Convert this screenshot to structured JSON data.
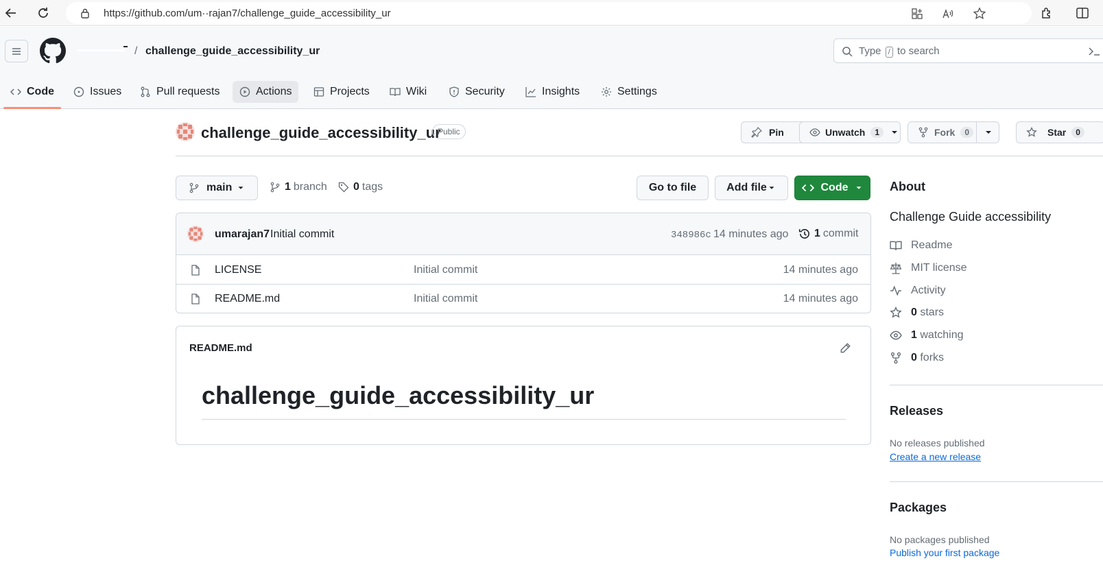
{
  "browser": {
    "url": "https://github.com/um··rajan7/challenge_guide_accessibility_ur"
  },
  "header": {
    "separator": "/",
    "repo_crumb": "challenge_guide_accessibility_ur",
    "search_prefix": "Type",
    "search_key": "/",
    "search_suffix": "to search"
  },
  "tabs": [
    {
      "label": "Code",
      "icon": "code-icon"
    },
    {
      "label": "Issues",
      "icon": "issue-icon"
    },
    {
      "label": "Pull requests",
      "icon": "pull-request-icon"
    },
    {
      "label": "Actions",
      "icon": "play-icon"
    },
    {
      "label": "Projects",
      "icon": "table-icon"
    },
    {
      "label": "Wiki",
      "icon": "book-icon"
    },
    {
      "label": "Security",
      "icon": "shield-icon"
    },
    {
      "label": "Insights",
      "icon": "graph-icon"
    },
    {
      "label": "Settings",
      "icon": "gear-icon"
    }
  ],
  "repo": {
    "name": "challenge_guide_accessibility_ur",
    "visibility": "Public",
    "pin": "Pin",
    "unwatch": "Unwatch",
    "watch_count": "1",
    "fork": "Fork",
    "fork_count": "0",
    "star": "Star",
    "star_count": "0"
  },
  "toolbar": {
    "branch": "main",
    "branch_count": "1",
    "branch_label": "branch",
    "tag_count": "0",
    "tag_label": "tags",
    "go_to_file": "Go to file",
    "add_file": "Add file",
    "code": "Code"
  },
  "commit": {
    "author": "umarajan7",
    "message": "Initial commit",
    "hash": "348986c",
    "time": "14 minutes ago",
    "count": "1",
    "count_label": "commit"
  },
  "files": [
    {
      "name": "LICENSE",
      "message": "Initial commit",
      "age": "14 minutes ago"
    },
    {
      "name": "README.md",
      "message": "Initial commit",
      "age": "14 minutes ago"
    }
  ],
  "readme": {
    "filename": "README.md",
    "heading": "challenge_guide_accessibility_ur"
  },
  "about": {
    "title": "About",
    "description": "Challenge Guide accessibility",
    "readme": "Readme",
    "license": "MIT license",
    "activity": "Activity",
    "stars_count": "0",
    "stars_label": "stars",
    "watching_count": "1",
    "watching_label": "watching",
    "forks_count": "0",
    "forks_label": "forks"
  },
  "releases": {
    "title": "Releases",
    "empty": "No releases published",
    "link": "Create a new release"
  },
  "packages": {
    "title": "Packages",
    "empty": "No packages published",
    "link": "Publish your first package"
  },
  "colors": {
    "accent_green": "#1f883d",
    "tab_underline": "#fd8c73",
    "link": "#0969da"
  }
}
